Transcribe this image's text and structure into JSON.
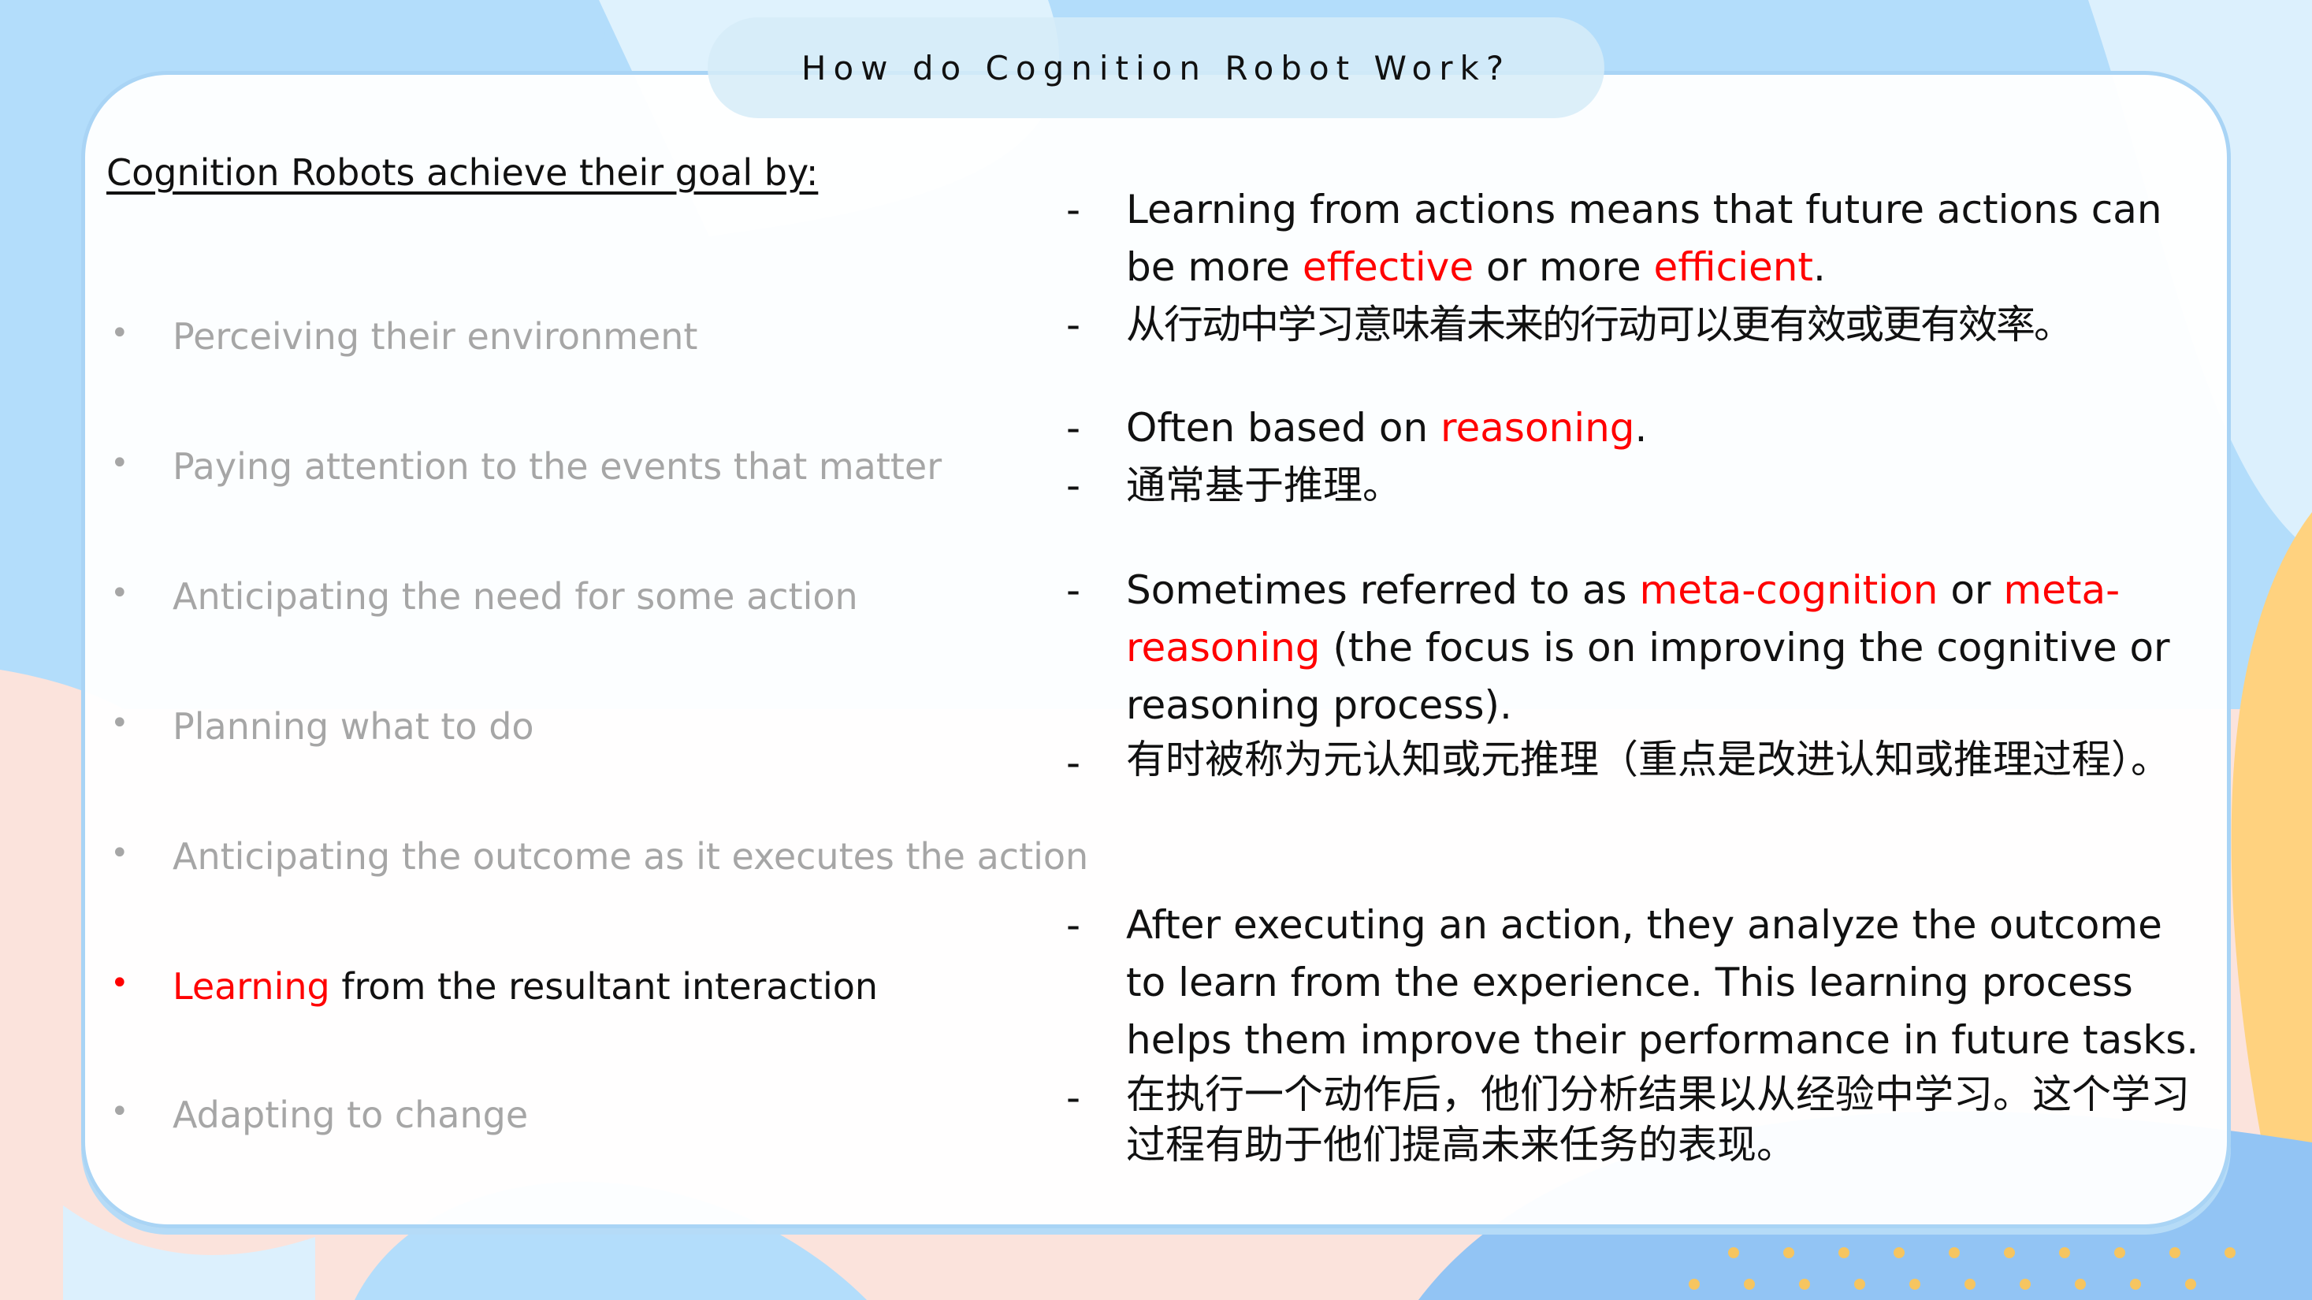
{
  "title": "How do Cognition Robot Work?",
  "heading": "Cognition Robots achieve their goal by:",
  "bullets": [
    {
      "text": "Perceiving their environment"
    },
    {
      "text": "Paying attention to the events that matter"
    },
    {
      "text": "Anticipating the need for some action"
    },
    {
      "text": "Planning what to do"
    },
    {
      "text": "Anticipating the outcome as it executes the action"
    },
    {
      "highlight": "Learning",
      "text": " from the resultant interaction"
    },
    {
      "text": "Adapting to change"
    }
  ],
  "right": {
    "b1": {
      "p1": "Learning from actions means that future actions can be more ",
      "r1": "effective",
      "p2": " or more ",
      "r2": "efficient",
      "p3": ".",
      "zh": "从行动中学习意味着未来的行动可以更有效或更有效率。"
    },
    "b2": {
      "p1": "Often based on ",
      "r1": "reasoning",
      "p2": ".",
      "zh": "通常基于推理。"
    },
    "b3": {
      "p1": "Sometimes referred to as ",
      "r1": "meta-cognition",
      "p2": " or ",
      "r2": "meta-reasoning",
      "p3": " (the focus is on improving the cognitive or reasoning process).",
      "zh": "有时被称为元认知或元推理（重点是改进认知或推理过程）。"
    },
    "b4": {
      "p1": "After executing an action, they analyze the outcome to learn from the experience. This learning process helps them improve their performance in future tasks.",
      "zh": "在执行一个动作后，他们分析结果以从经验中学习。这个学习过程有助于他们提高未来任务的表现。"
    },
    "dash": "-"
  },
  "colors": {
    "accent": "#ff0000",
    "muted": "#a6a6a6",
    "border": "#a9d4f5"
  }
}
